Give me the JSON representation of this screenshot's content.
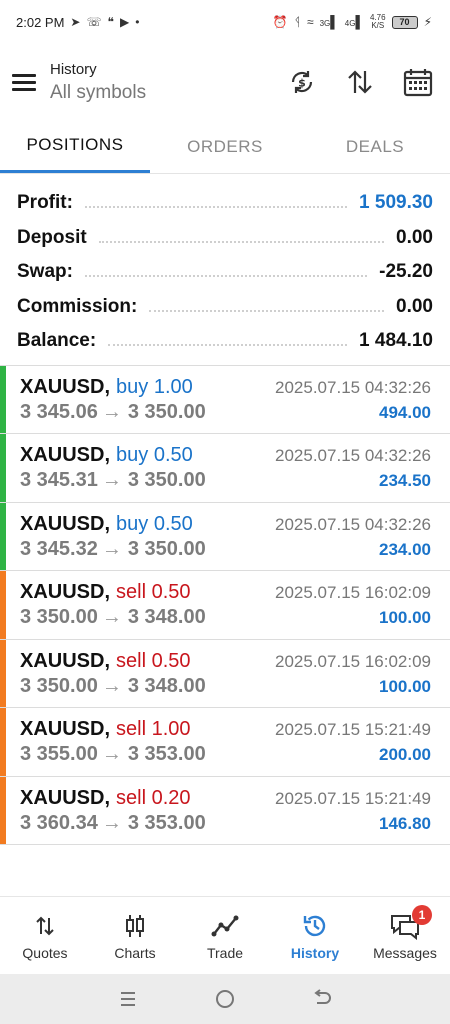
{
  "status_bar": {
    "time": "2:02 PM",
    "net_speed": "4.76",
    "net_unit": "K/S",
    "battery": "70",
    "sig1": "3G",
    "sig2": "4G"
  },
  "header": {
    "title": "History",
    "subtitle": "All symbols"
  },
  "tabs": [
    {
      "label": "POSITIONS",
      "active": true
    },
    {
      "label": "ORDERS",
      "active": false
    },
    {
      "label": "DEALS",
      "active": false
    }
  ],
  "summary": {
    "profit_label": "Profit:",
    "profit_value": "1 509.30",
    "deposit_label": "Deposit",
    "deposit_value": "0.00",
    "swap_label": "Swap:",
    "swap_value": "-25.20",
    "commission_label": "Commission:",
    "commission_value": "0.00",
    "balance_label": "Balance:",
    "balance_value": "1 484.10"
  },
  "deals": [
    {
      "symbol": "XAUUSD,",
      "direction": "buy 1.00",
      "type": "buy",
      "time": "2025.07.15 04:32:26",
      "open": "3 345.06",
      "close": "3 350.00",
      "profit": "494.00"
    },
    {
      "symbol": "XAUUSD,",
      "direction": "buy 0.50",
      "type": "buy",
      "time": "2025.07.15 04:32:26",
      "open": "3 345.31",
      "close": "3 350.00",
      "profit": "234.50"
    },
    {
      "symbol": "XAUUSD,",
      "direction": "buy 0.50",
      "type": "buy",
      "time": "2025.07.15 04:32:26",
      "open": "3 345.32",
      "close": "3 350.00",
      "profit": "234.00"
    },
    {
      "symbol": "XAUUSD,",
      "direction": "sell 0.50",
      "type": "sell",
      "time": "2025.07.15 16:02:09",
      "open": "3 350.00",
      "close": "3 348.00",
      "profit": "100.00"
    },
    {
      "symbol": "XAUUSD,",
      "direction": "sell 0.50",
      "type": "sell",
      "time": "2025.07.15 16:02:09",
      "open": "3 350.00",
      "close": "3 348.00",
      "profit": "100.00"
    },
    {
      "symbol": "XAUUSD,",
      "direction": "sell 1.00",
      "type": "sell",
      "time": "2025.07.15 15:21:49",
      "open": "3 355.00",
      "close": "3 353.00",
      "profit": "200.00"
    },
    {
      "symbol": "XAUUSD,",
      "direction": "sell 0.20",
      "type": "sell",
      "time": "2025.07.15 15:21:49",
      "open": "3 360.34",
      "close": "3 353.00",
      "profit": "146.80"
    }
  ],
  "price_arrow": "→",
  "bottom_nav": [
    {
      "label": "Quotes",
      "icon": "quotes-icon"
    },
    {
      "label": "Charts",
      "icon": "charts-icon"
    },
    {
      "label": "Trade",
      "icon": "trade-icon"
    },
    {
      "label": "History",
      "icon": "history-icon",
      "active": true
    },
    {
      "label": "Messages",
      "icon": "messages-icon",
      "badge": "1"
    }
  ],
  "colors": {
    "accent": "#2d7fd3",
    "buy": "#1a73c9",
    "sell": "#c8161d",
    "buy_bar": "#2fb344",
    "sell_bar": "#f27b20"
  }
}
